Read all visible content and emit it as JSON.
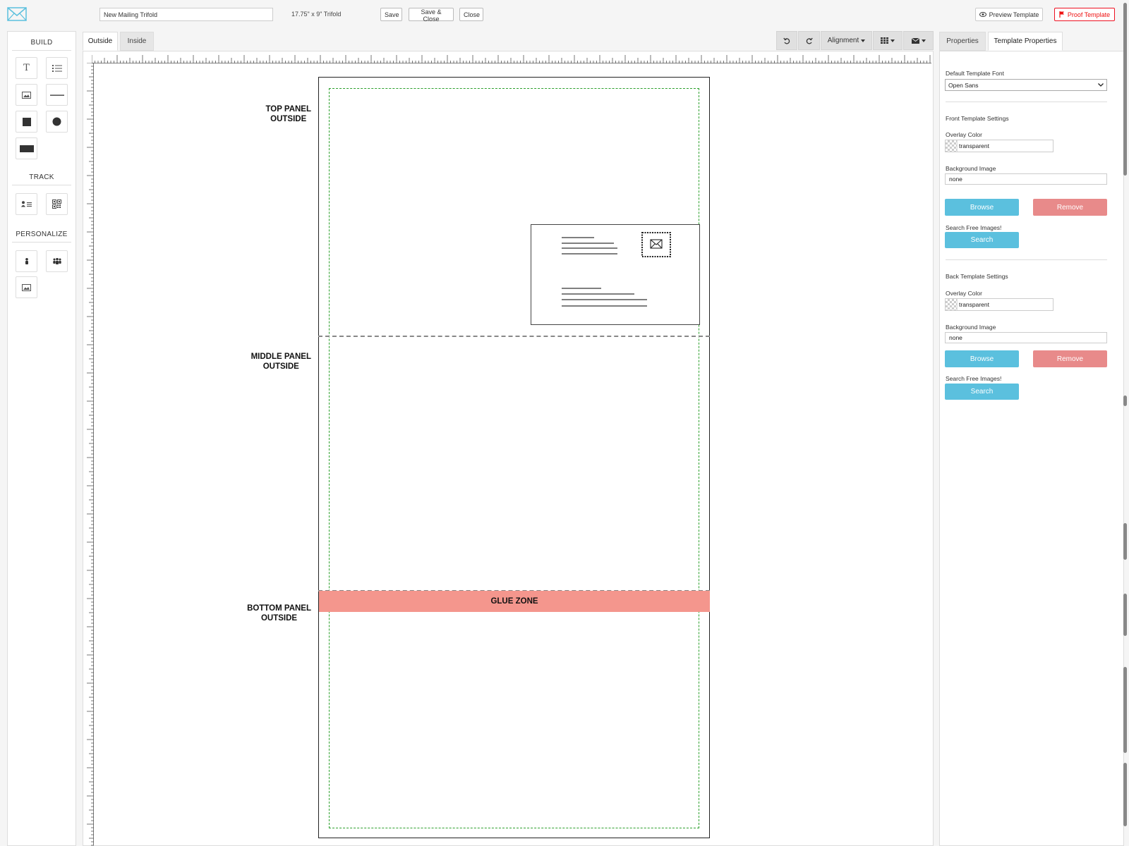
{
  "header": {
    "template_name_value": "New Mailing Trifold",
    "size_label": "17.75\" x 9\" Trifold",
    "save_label": "Save",
    "save_close_label": "Save & Close",
    "close_label": "Close",
    "preview_label": "Preview Template",
    "proof_label": "Proof Template"
  },
  "sidebar": {
    "build_title": "BUILD",
    "track_title": "TRACK",
    "personalize_title": "PERSONALIZE"
  },
  "editor": {
    "tabs": [
      {
        "label": "Outside",
        "active": true
      },
      {
        "label": "Inside",
        "active": false
      }
    ],
    "alignment_label": "Alignment",
    "panels": {
      "top_line1": "TOP PANEL",
      "top_line2": "OUTSIDE",
      "middle_line1": "MIDDLE PANEL",
      "middle_line2": "OUTSIDE",
      "bottom_line1": "BOTTOM PANEL",
      "bottom_line2": "OUTSIDE"
    },
    "glue_zone_label": "GLUE ZONE"
  },
  "properties": {
    "tabs": [
      {
        "label": "Properties",
        "active": false
      },
      {
        "label": "Template Properties",
        "active": true
      }
    ],
    "default_font_label": "Default Template Font",
    "default_font_value": "Open Sans",
    "front": {
      "section_title": "Front Template Settings",
      "overlay_label": "Overlay Color",
      "overlay_value": "transparent",
      "bg_image_label": "Background Image",
      "bg_image_value": "none",
      "browse_label": "Browse",
      "remove_label": "Remove",
      "search_free_label": "Search Free Images!",
      "search_label": "Search"
    },
    "back": {
      "section_title": "Back Template Settings",
      "overlay_label": "Overlay Color",
      "overlay_value": "transparent",
      "bg_image_label": "Background Image",
      "bg_image_value": "none",
      "browse_label": "Browse",
      "remove_label": "Remove",
      "search_free_label": "Search Free Images!",
      "search_label": "Search"
    }
  },
  "colors": {
    "info_button": "#5bc0de",
    "danger_button": "#e88a8a",
    "glue_zone": "#f4968d",
    "safe_zone_border": "#2ca02c",
    "proof_accent": "#e11111"
  },
  "icons": [
    "mail-logo-icon",
    "eye-icon",
    "flag-icon",
    "text-icon",
    "list-icon",
    "image-icon",
    "line-icon",
    "square-icon",
    "circle-icon",
    "rectangle-icon",
    "contact-icon",
    "qr-code-icon",
    "person-icon",
    "group-icon",
    "personal-image-icon",
    "undo-icon",
    "redo-icon",
    "caret-down-icon",
    "grid-icon",
    "envelope-icon",
    "stamp-icon"
  ]
}
